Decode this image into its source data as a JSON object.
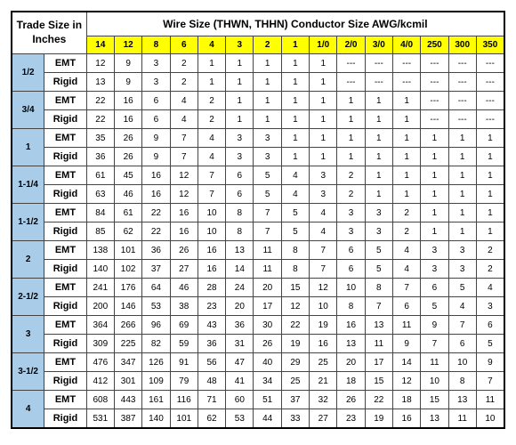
{
  "header": {
    "trade_size": "Trade Size\nin Inches",
    "wire_size": "Wire Size (THWN, THHN) Conductor Size AWG/kcmil"
  },
  "columns": [
    "14",
    "12",
    "8",
    "6",
    "4",
    "3",
    "2",
    "1",
    "1/0",
    "2/0",
    "3/0",
    "4/0",
    "250",
    "300",
    "350"
  ],
  "sizes": [
    {
      "label": "1/2",
      "rows": [
        {
          "type": "EMT",
          "vals": [
            "12",
            "9",
            "3",
            "2",
            "1",
            "1",
            "1",
            "1",
            "1",
            "---",
            "---",
            "---",
            "---",
            "---",
            "---"
          ]
        },
        {
          "type": "Rigid",
          "vals": [
            "13",
            "9",
            "3",
            "2",
            "1",
            "1",
            "1",
            "1",
            "1",
            "---",
            "---",
            "---",
            "---",
            "---",
            "---"
          ]
        }
      ]
    },
    {
      "label": "3/4",
      "rows": [
        {
          "type": "EMT",
          "vals": [
            "22",
            "16",
            "6",
            "4",
            "2",
            "1",
            "1",
            "1",
            "1",
            "1",
            "1",
            "1",
            "---",
            "---",
            "---"
          ]
        },
        {
          "type": "Rigid",
          "vals": [
            "22",
            "16",
            "6",
            "4",
            "2",
            "1",
            "1",
            "1",
            "1",
            "1",
            "1",
            "1",
            "---",
            "---",
            "---"
          ]
        }
      ]
    },
    {
      "label": "1",
      "rows": [
        {
          "type": "EMT",
          "vals": [
            "35",
            "26",
            "9",
            "7",
            "4",
            "3",
            "3",
            "1",
            "1",
            "1",
            "1",
            "1",
            "1",
            "1",
            "1"
          ]
        },
        {
          "type": "Rigid",
          "vals": [
            "36",
            "26",
            "9",
            "7",
            "4",
            "3",
            "3",
            "1",
            "1",
            "1",
            "1",
            "1",
            "1",
            "1",
            "1"
          ]
        }
      ]
    },
    {
      "label": "1-1/4",
      "rows": [
        {
          "type": "EMT",
          "vals": [
            "61",
            "45",
            "16",
            "12",
            "7",
            "6",
            "5",
            "4",
            "3",
            "2",
            "1",
            "1",
            "1",
            "1",
            "1"
          ]
        },
        {
          "type": "Rigid",
          "vals": [
            "63",
            "46",
            "16",
            "12",
            "7",
            "6",
            "5",
            "4",
            "3",
            "2",
            "1",
            "1",
            "1",
            "1",
            "1"
          ]
        }
      ]
    },
    {
      "label": "1-1/2",
      "rows": [
        {
          "type": "EMT",
          "vals": [
            "84",
            "61",
            "22",
            "16",
            "10",
            "8",
            "7",
            "5",
            "4",
            "3",
            "3",
            "2",
            "1",
            "1",
            "1"
          ]
        },
        {
          "type": "Rigid",
          "vals": [
            "85",
            "62",
            "22",
            "16",
            "10",
            "8",
            "7",
            "5",
            "4",
            "3",
            "3",
            "2",
            "1",
            "1",
            "1"
          ]
        }
      ]
    },
    {
      "label": "2",
      "rows": [
        {
          "type": "EMT",
          "vals": [
            "138",
            "101",
            "36",
            "26",
            "16",
            "13",
            "11",
            "8",
            "7",
            "6",
            "5",
            "4",
            "3",
            "3",
            "2"
          ]
        },
        {
          "type": "Rigid",
          "vals": [
            "140",
            "102",
            "37",
            "27",
            "16",
            "14",
            "11",
            "8",
            "7",
            "6",
            "5",
            "4",
            "3",
            "3",
            "2"
          ]
        }
      ]
    },
    {
      "label": "2-1/2",
      "rows": [
        {
          "type": "EMT",
          "vals": [
            "241",
            "176",
            "64",
            "46",
            "28",
            "24",
            "20",
            "15",
            "12",
            "10",
            "8",
            "7",
            "6",
            "5",
            "4"
          ]
        },
        {
          "type": "Rigid",
          "vals": [
            "200",
            "146",
            "53",
            "38",
            "23",
            "20",
            "17",
            "12",
            "10",
            "8",
            "7",
            "6",
            "5",
            "4",
            "3"
          ]
        }
      ]
    },
    {
      "label": "3",
      "rows": [
        {
          "type": "EMT",
          "vals": [
            "364",
            "266",
            "96",
            "69",
            "43",
            "36",
            "30",
            "22",
            "19",
            "16",
            "13",
            "11",
            "9",
            "7",
            "6"
          ]
        },
        {
          "type": "Rigid",
          "vals": [
            "309",
            "225",
            "82",
            "59",
            "36",
            "31",
            "26",
            "19",
            "16",
            "13",
            "11",
            "9",
            "7",
            "6",
            "5"
          ]
        }
      ]
    },
    {
      "label": "3-1/2",
      "rows": [
        {
          "type": "EMT",
          "vals": [
            "476",
            "347",
            "126",
            "91",
            "56",
            "47",
            "40",
            "29",
            "25",
            "20",
            "17",
            "14",
            "11",
            "10",
            "9"
          ]
        },
        {
          "type": "Rigid",
          "vals": [
            "412",
            "301",
            "109",
            "79",
            "48",
            "41",
            "34",
            "25",
            "21",
            "18",
            "15",
            "12",
            "10",
            "8",
            "7"
          ]
        }
      ]
    },
    {
      "label": "4",
      "rows": [
        {
          "type": "EMT",
          "vals": [
            "608",
            "443",
            "161",
            "116",
            "71",
            "60",
            "51",
            "37",
            "32",
            "26",
            "22",
            "18",
            "15",
            "13",
            "11"
          ]
        },
        {
          "type": "Rigid",
          "vals": [
            "531",
            "387",
            "140",
            "101",
            "62",
            "53",
            "44",
            "33",
            "27",
            "23",
            "19",
            "16",
            "13",
            "11",
            "10"
          ]
        }
      ]
    }
  ]
}
